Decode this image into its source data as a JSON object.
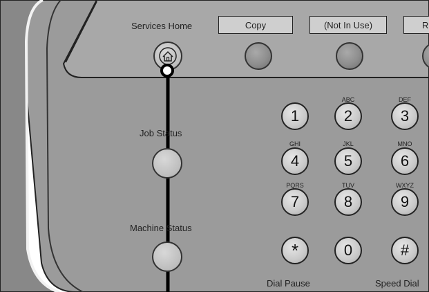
{
  "top_row": {
    "services_home": "Services Home",
    "copy": "Copy",
    "not_in_use": "(Not In Use)",
    "partial": "R"
  },
  "side": {
    "job_status": "Job Status",
    "machine_status": "Machine Status"
  },
  "keypad": {
    "keys": [
      {
        "digit": "1",
        "letters": ""
      },
      {
        "digit": "2",
        "letters": "ABC"
      },
      {
        "digit": "3",
        "letters": "DEF"
      },
      {
        "digit": "4",
        "letters": "GHI"
      },
      {
        "digit": "5",
        "letters": "JKL"
      },
      {
        "digit": "6",
        "letters": "MNO"
      },
      {
        "digit": "7",
        "letters": "PQRS"
      },
      {
        "digit": "8",
        "letters": "TUV"
      },
      {
        "digit": "9",
        "letters": "WXYZ"
      },
      {
        "digit": "*",
        "letters": ""
      },
      {
        "digit": "0",
        "letters": ""
      },
      {
        "digit": "#",
        "letters": ""
      }
    ]
  },
  "bottom": {
    "dial_pause": "Dial Pause",
    "speed_dial": "Speed Dial"
  },
  "colors": {
    "panel": "#9a9a9a",
    "upper_band": "#a5a5a5",
    "outline": "#222222",
    "callout": "#000000"
  }
}
